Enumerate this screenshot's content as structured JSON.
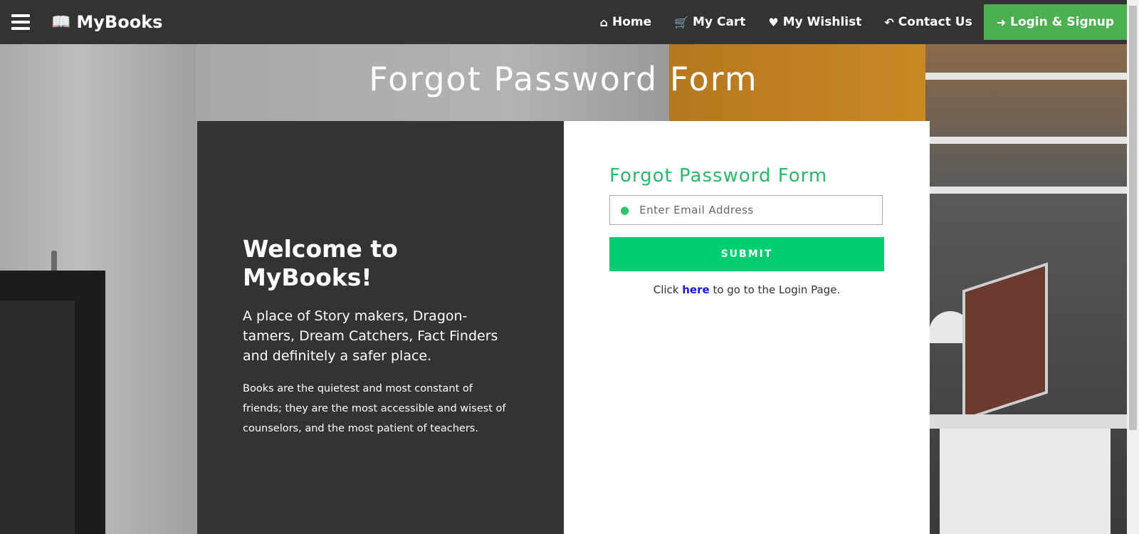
{
  "navbar": {
    "brand": "MyBooks",
    "brand_icon": "book-icon",
    "links": [
      {
        "label": "Home",
        "icon": "home-icon"
      },
      {
        "label": "My Cart",
        "icon": "cart-icon"
      },
      {
        "label": "My Wishlist",
        "icon": "heart-icon"
      },
      {
        "label": "Contact Us",
        "icon": "reply-icon"
      }
    ],
    "login": {
      "label": "Login & Signup",
      "icon": "sign-in-icon"
    }
  },
  "page": {
    "title": "Forgot Password Form"
  },
  "welcome": {
    "title": "Welcome to MyBooks!",
    "tagline": "A place of Story makers, Dragon-tamers, Dream Catchers, Fact Finders and definitely a safer place.",
    "quote": "Books are the quietest and most constant of friends; they are the most accessible and wisest of counselors, and the most patient of teachers."
  },
  "form": {
    "title": "Forgot Password Form",
    "email_placeholder": "Enter Email Address",
    "email_value": "",
    "submit_label": "SUBMIT",
    "login_prefix": "Click ",
    "login_link": "here",
    "login_suffix": " to go to the Login Page."
  },
  "colors": {
    "navbar_bg": "#333333",
    "login_btn": "#4CAF50",
    "accent_green": "#2ab96a",
    "submit_btn": "#00cc70",
    "link_blue": "#1a1ad4"
  }
}
